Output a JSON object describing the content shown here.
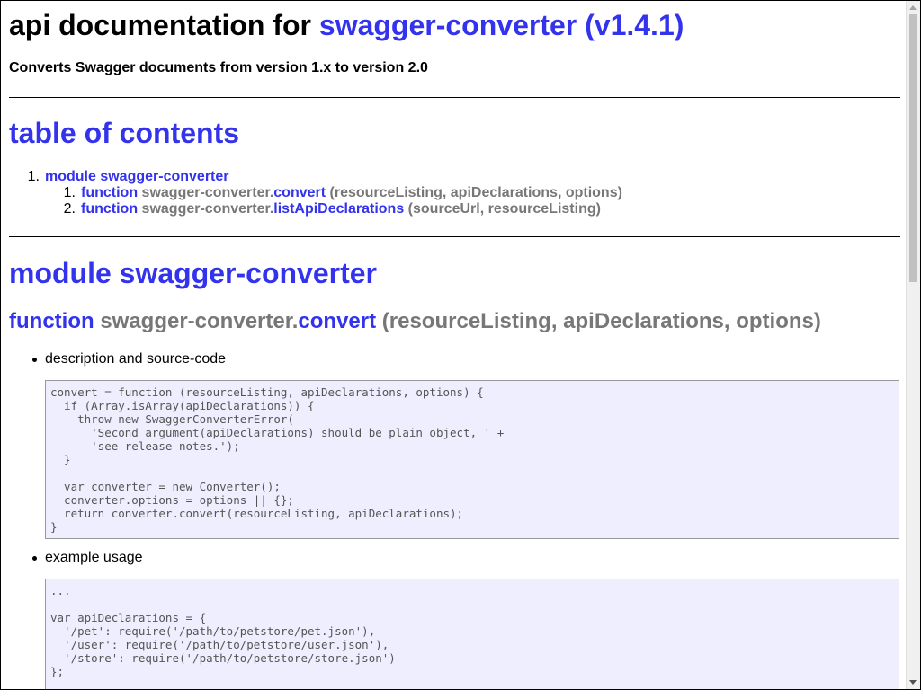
{
  "header": {
    "title_prefix": "api documentation for",
    "title_link": "swagger-converter (v1.4.1)",
    "subtitle": "Converts Swagger documents from version 1.x to version 2.0"
  },
  "toc": {
    "heading": "table of contents",
    "module": {
      "num": "1.",
      "label": "module swagger-converter"
    },
    "items": [
      {
        "num": "1.",
        "keyword": "function",
        "prefix": "swagger-converter.",
        "name": "convert",
        "args": "(resourceListing, apiDeclarations, options)"
      },
      {
        "num": "2.",
        "keyword": "function",
        "prefix": "swagger-converter.",
        "name": "listApiDeclarations",
        "args": "(sourceUrl, resourceListing)"
      }
    ]
  },
  "module_section": {
    "heading": "module swagger-converter",
    "function": {
      "keyword": "function",
      "prefix": "swagger-converter.",
      "name": "convert",
      "args": "(resourceListing, apiDeclarations, options)"
    },
    "bullets": {
      "description": "description and source-code",
      "example": "example usage"
    },
    "source_code": "convert = function (resourceListing, apiDeclarations, options) {\n  if (Array.isArray(apiDeclarations)) {\n    throw new SwaggerConverterError(\n      'Second argument(apiDeclarations) should be plain object, ' +\n      'see release notes.');\n  }\n\n  var converter = new Converter();\n  converter.options = options || {};\n  return converter.convert(resourceListing, apiDeclarations);\n}",
    "example_code": "...\n\nvar apiDeclarations = {\n  '/pet': require('/path/to/petstore/pet.json'),\n  '/user': require('/path/to/petstore/user.json'),\n  '/store': require('/path/to/petstore/store.json')\n};"
  },
  "colors": {
    "link": "#3333ee",
    "muted": "#777777",
    "code_bg": "#eeeeff"
  }
}
